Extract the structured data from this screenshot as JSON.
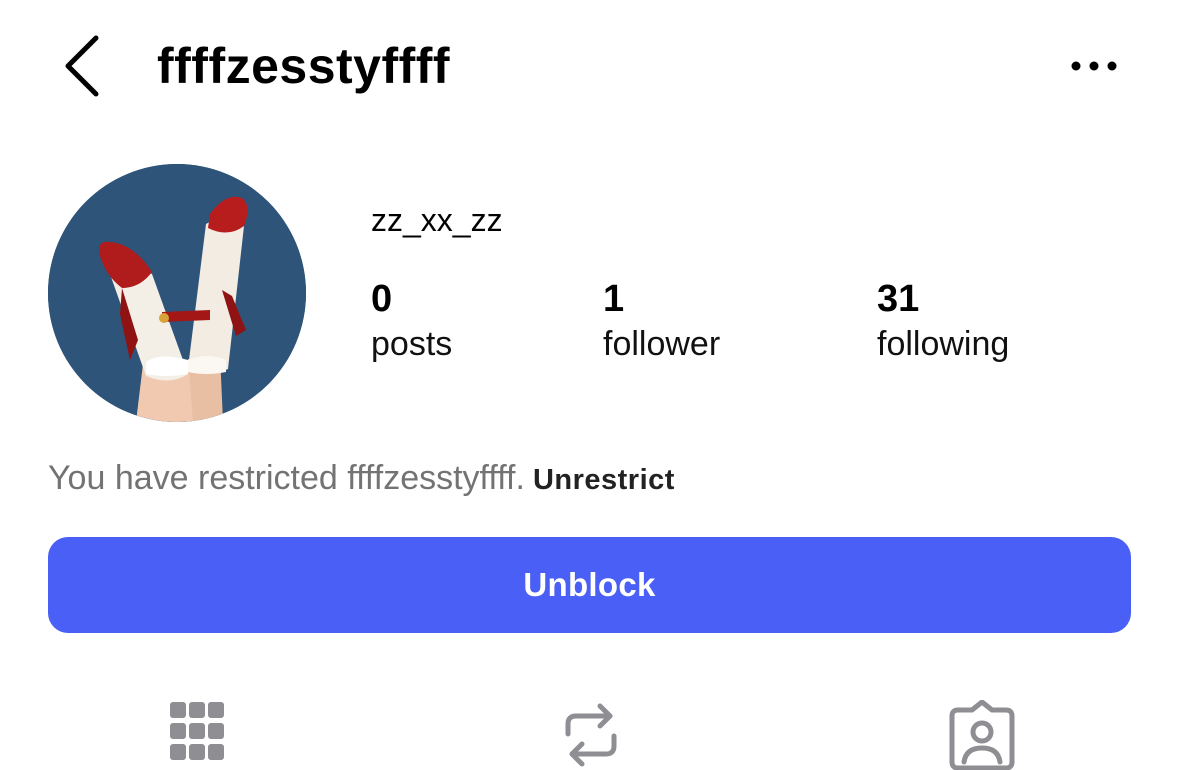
{
  "header": {
    "back_icon": "chevron-left-icon",
    "title": "ffffzesstyffff",
    "more_icon": "more-horizontal-icon"
  },
  "profile": {
    "avatar": "illustration of legs with white socks and red shoes on blue background",
    "display_name": "zz_xx_zz",
    "stats": [
      {
        "value": "0",
        "label": "posts"
      },
      {
        "value": "1",
        "label": "follower"
      },
      {
        "value": "31",
        "label": "following"
      }
    ]
  },
  "restriction": {
    "text": "You have restricted ffffzesstyffff.",
    "link": "Unrestrict"
  },
  "actions": {
    "unblock_label": "Unblock",
    "unblock_color": "#4a5ff5"
  },
  "tabs": [
    {
      "icon": "grid-icon"
    },
    {
      "icon": "reposts-icon"
    },
    {
      "icon": "tagged-icon"
    }
  ],
  "colors": {
    "icon_gray": "#8e8e93",
    "muted_text": "#737373",
    "avatar_bg": "#2e5479",
    "shoe_red": "#b01b1b"
  }
}
